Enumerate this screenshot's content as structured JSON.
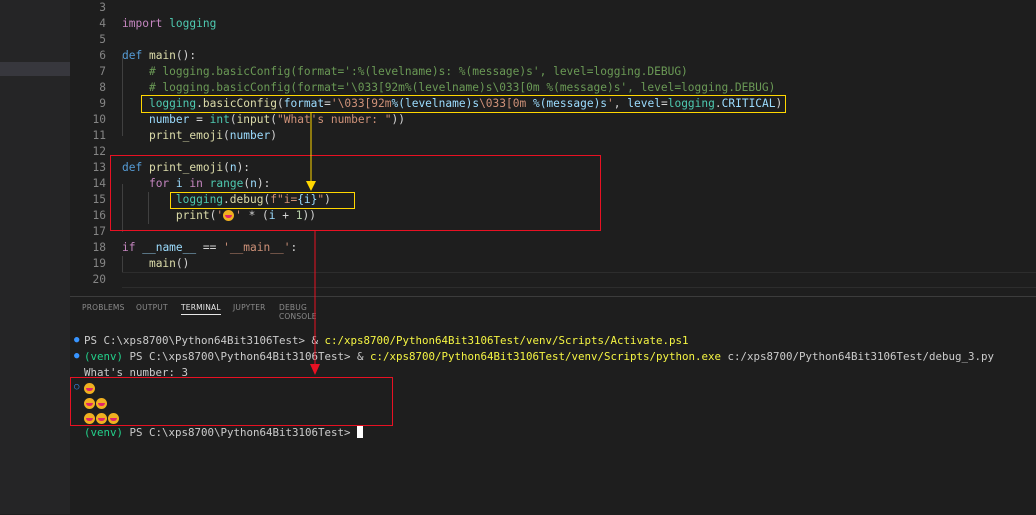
{
  "editor": {
    "lines": [
      {
        "n": "3",
        "segs": []
      },
      {
        "n": "4",
        "segs": [
          {
            "t": "import",
            "c": "c"
          },
          {
            "t": " logging",
            "c": "n"
          }
        ]
      },
      {
        "n": "5",
        "segs": []
      },
      {
        "n": "6",
        "segs": [
          {
            "t": "def",
            "c": "k"
          },
          {
            "t": " "
          },
          {
            "t": "main",
            "c": "f"
          },
          {
            "t": "():"
          }
        ]
      },
      {
        "n": "7",
        "segs": [
          {
            "t": "    "
          },
          {
            "t": "# logging.basicConfig(format=':%(levelname)s: %(message)s', level=logging.DEBUG)",
            "c": "cm"
          }
        ]
      },
      {
        "n": "8",
        "segs": [
          {
            "t": "    "
          },
          {
            "t": "# logging.basicConfig(format='\\033[92m%(levelname)s\\033[0m %(message)s', level=logging.DEBUG)",
            "c": "cm"
          }
        ]
      },
      {
        "n": "9",
        "segs": [
          {
            "t": "    "
          },
          {
            "t": "logging",
            "c": "n"
          },
          {
            "t": "."
          },
          {
            "t": "basicConfig",
            "c": "f"
          },
          {
            "t": "("
          },
          {
            "t": "format",
            "c": "v"
          },
          {
            "t": "="
          },
          {
            "t": "'\\033[92m",
            "c": "s"
          },
          {
            "t": "%(levelname)s",
            "c": "v"
          },
          {
            "t": "\\033[0m ",
            "c": "s"
          },
          {
            "t": "%(message)s",
            "c": "v"
          },
          {
            "t": "'",
            "c": "s"
          },
          {
            "t": ", "
          },
          {
            "t": "level",
            "c": "v"
          },
          {
            "t": "="
          },
          {
            "t": "logging",
            "c": "n"
          },
          {
            "t": "."
          },
          {
            "t": "CRITICAL",
            "c": "v"
          },
          {
            "t": ")"
          }
        ]
      },
      {
        "n": "10",
        "segs": [
          {
            "t": "    "
          },
          {
            "t": "number",
            "c": "v"
          },
          {
            "t": " = "
          },
          {
            "t": "int",
            "c": "n"
          },
          {
            "t": "("
          },
          {
            "t": "input",
            "c": "f"
          },
          {
            "t": "("
          },
          {
            "t": "\"What's number: \"",
            "c": "s"
          },
          {
            "t": "))"
          }
        ]
      },
      {
        "n": "11",
        "segs": [
          {
            "t": "    "
          },
          {
            "t": "print_emoji",
            "c": "f"
          },
          {
            "t": "("
          },
          {
            "t": "number",
            "c": "v"
          },
          {
            "t": ")"
          }
        ]
      },
      {
        "n": "12",
        "segs": []
      },
      {
        "n": "13",
        "segs": [
          {
            "t": "def",
            "c": "k"
          },
          {
            "t": " "
          },
          {
            "t": "print_emoji",
            "c": "f"
          },
          {
            "t": "("
          },
          {
            "t": "n",
            "c": "v"
          },
          {
            "t": "):"
          }
        ]
      },
      {
        "n": "14",
        "segs": [
          {
            "t": "    "
          },
          {
            "t": "for",
            "c": "c"
          },
          {
            "t": " "
          },
          {
            "t": "i",
            "c": "v"
          },
          {
            "t": " "
          },
          {
            "t": "in",
            "c": "c"
          },
          {
            "t": " "
          },
          {
            "t": "range",
            "c": "n"
          },
          {
            "t": "("
          },
          {
            "t": "n",
            "c": "v"
          },
          {
            "t": "):"
          }
        ]
      },
      {
        "n": "15",
        "segs": [
          {
            "t": "        "
          },
          {
            "t": "logging",
            "c": "n"
          },
          {
            "t": "."
          },
          {
            "t": "debug",
            "c": "f"
          },
          {
            "t": "("
          },
          {
            "t": "f\"i=",
            "c": "s"
          },
          {
            "t": "{i}",
            "c": "v"
          },
          {
            "t": "\"",
            "c": "s"
          },
          {
            "t": ")"
          }
        ]
      },
      {
        "n": "16",
        "segs": [
          {
            "t": "        "
          },
          {
            "t": "print",
            "c": "f"
          },
          {
            "t": "("
          },
          {
            "t": "'",
            "c": "s"
          },
          {
            "t": "EMOJI",
            "c": "emoji"
          },
          {
            "t": "'",
            "c": "s"
          },
          {
            "t": " * ("
          },
          {
            "t": "i",
            "c": "v"
          },
          {
            "t": " + "
          },
          {
            "t": "1",
            "c": "num"
          },
          {
            "t": "))"
          }
        ]
      },
      {
        "n": "17",
        "segs": []
      },
      {
        "n": "18",
        "segs": [
          {
            "t": "if",
            "c": "c"
          },
          {
            "t": " "
          },
          {
            "t": "__name__",
            "c": "v"
          },
          {
            "t": " == "
          },
          {
            "t": "'__main__'",
            "c": "s"
          },
          {
            "t": ":"
          }
        ]
      },
      {
        "n": "19",
        "segs": [
          {
            "t": "    "
          },
          {
            "t": "main",
            "c": "f"
          },
          {
            "t": "()"
          }
        ]
      },
      {
        "n": "20",
        "segs": []
      }
    ]
  },
  "panel": {
    "tabs": [
      "PROBLEMS",
      "OUTPUT",
      "TERMINAL",
      "JUPYTER",
      "DEBUG CONSOLE"
    ],
    "active_tab": "TERMINAL"
  },
  "terminal": {
    "line1_prompt": "PS C:\\xps8700\\Python64Bit3106Test> & ",
    "line1_cmd": "c:/xps8700/Python64Bit3106Test/venv/Scripts/Activate.ps1",
    "line2_env": "(venv)",
    "line2_prompt": " PS C:\\xps8700\\Python64Bit3106Test> & ",
    "line2_cmd": "c:/xps8700/Python64Bit3106Test/venv/Scripts/python.exe",
    "line2_arg": " c:/xps8700/Python64Bit3106Test/debug_3.py",
    "line3": "What's number: 3",
    "emoji_rows": [
      1,
      2,
      3
    ],
    "last_env": "(venv)",
    "last_prompt": " PS C:\\xps8700\\Python64Bit3106Test> "
  },
  "colors": {
    "yellow_box": "#ffd700",
    "red_box": "#e81123"
  }
}
